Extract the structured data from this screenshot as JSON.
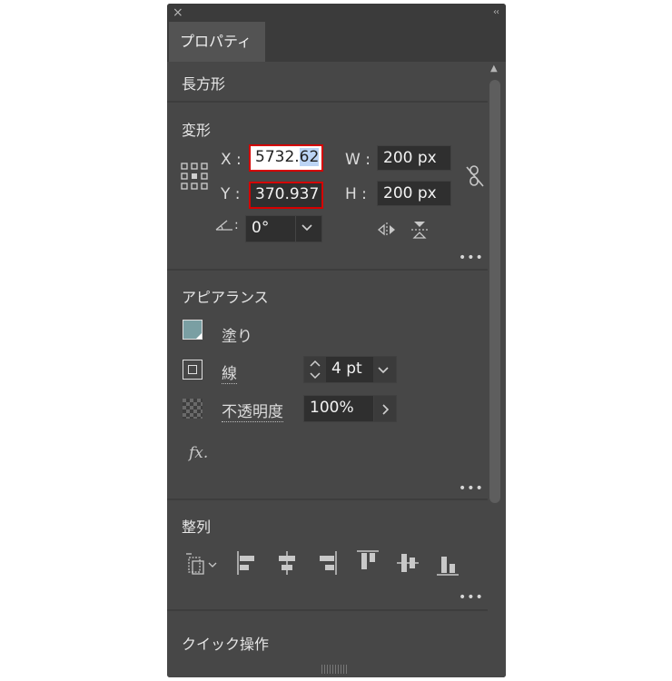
{
  "panel": {
    "tab_label": "プロパティ",
    "close_glyph": "×",
    "collapse_glyph": "‹‹",
    "object_type": "長方形"
  },
  "transform": {
    "title": "変形",
    "x_label": "X :",
    "x_value_main": "5732.",
    "x_value_selected": "62",
    "y_label": "Y :",
    "y_value": "370.937",
    "w_label": "W :",
    "w_value": "200 px",
    "h_label": "H :",
    "h_value": "200 px",
    "angle_label": ":",
    "angle_value": "0°",
    "more": "•••"
  },
  "appearance": {
    "title": "アピアランス",
    "fill_label": "塗り",
    "fill_color": "#7a9fa3",
    "stroke_label": "線",
    "stroke_value": "4 pt",
    "opacity_label": "不透明度",
    "opacity_value": "100%",
    "fx_label": "fx.",
    "more": "•••"
  },
  "align": {
    "title": "整列",
    "more": "•••"
  },
  "quick_actions": {
    "title": "クイック操作"
  }
}
